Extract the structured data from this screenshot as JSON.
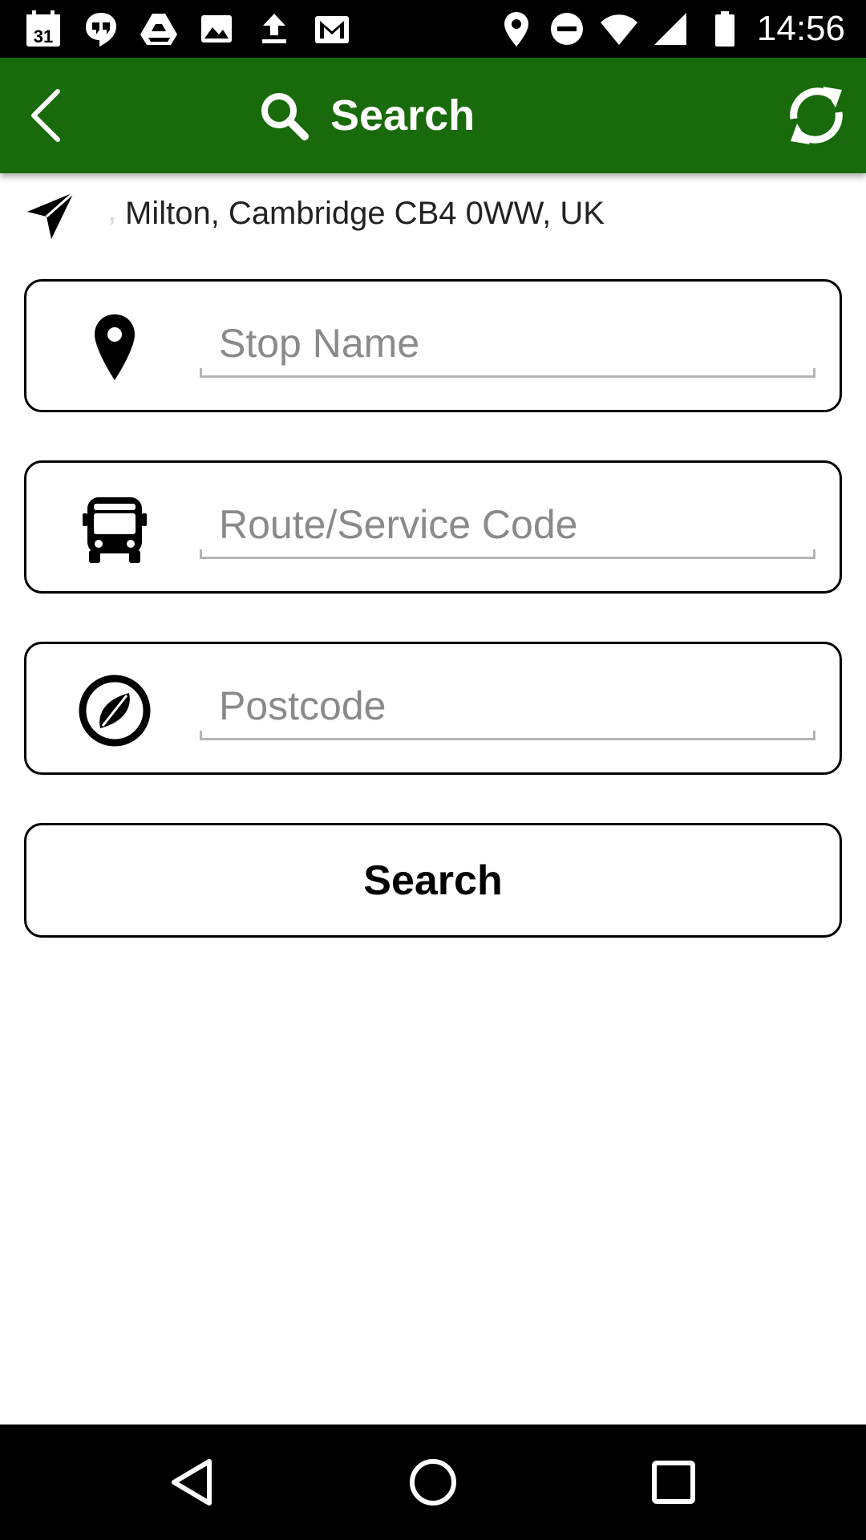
{
  "status_bar": {
    "time": "14:56",
    "calendar_date": "31",
    "icons": [
      "calendar-icon",
      "hangouts-icon",
      "drive-icon",
      "photos-icon",
      "upload-icon",
      "gmail-icon",
      "location-icon",
      "do-not-disturb-icon",
      "wifi-icon",
      "signal-icon",
      "battery-icon"
    ]
  },
  "app_bar": {
    "title": "Search",
    "background_color": "#196a0a",
    "icons": [
      "back-arrow-icon",
      "search-icon",
      "refresh-icon"
    ]
  },
  "location": {
    "prefix": ",",
    "address": "Milton, Cambridge CB4 0WW, UK",
    "icon": "navigation-arrow-icon"
  },
  "fields": {
    "stop_name": {
      "placeholder": "Stop Name",
      "value": "",
      "icon": "map-pin-icon"
    },
    "route_code": {
      "placeholder": "Route/Service Code",
      "value": "",
      "icon": "bus-icon"
    },
    "postcode": {
      "placeholder": "Postcode",
      "value": "",
      "icon": "compass-icon"
    }
  },
  "search_button": {
    "label": "Search"
  },
  "nav_bar": {
    "icons": [
      "back-triangle-icon",
      "home-circle-icon",
      "recents-square-icon"
    ]
  }
}
